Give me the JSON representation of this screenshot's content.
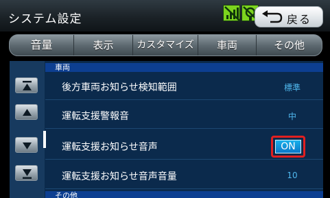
{
  "header": {
    "title": "システム設定",
    "back_label": "戻る",
    "status_icons": [
      "signal-off-icon",
      "gps-off-icon"
    ]
  },
  "tabs": [
    {
      "label": "音量"
    },
    {
      "label": "表示"
    },
    {
      "label": "カスタマイズ"
    },
    {
      "label": "車両"
    },
    {
      "label": "その他"
    }
  ],
  "sidebar": {
    "buttons": [
      "scroll-top-icon",
      "scroll-up-icon",
      "scroll-down-icon",
      "scroll-bottom-icon"
    ]
  },
  "sections": {
    "vehicle": "車両",
    "other": "その他"
  },
  "rows": [
    {
      "label": "後方車両お知らせ検知範囲",
      "value": "標準"
    },
    {
      "label": "運転支援警報音",
      "value": "中"
    },
    {
      "label": "運転支援お知らせ音声",
      "value": "ON"
    },
    {
      "label": "運転支援お知らせ音声音量",
      "value": "10"
    }
  ],
  "colors": {
    "accent_blue": "#50b8ee",
    "section_bar": "#0d3f91",
    "highlight_border": "#e22020",
    "status_green": "#7cd41e"
  }
}
